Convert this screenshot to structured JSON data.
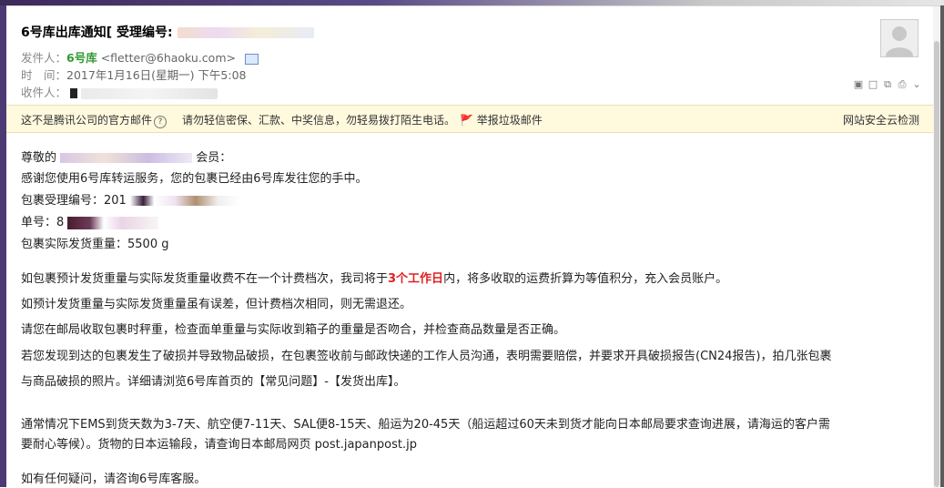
{
  "email": {
    "subject_prefix": "6号库出库通知[ 受理编号:",
    "from_label": "发件人：",
    "from_name": "6号库",
    "from_email": "<fletter@6haoku.com>",
    "time_label": "时　间：",
    "time_value": "2017年1月16日(星期一) 下午5:08",
    "to_label": "收件人："
  },
  "banner": {
    "notice": "这不是腾讯公司的官方邮件",
    "help": "?",
    "warning": "请勿轻信密保、汇款、中奖信息，勿轻易拨打陌生电话。",
    "report": "举报垃圾邮件",
    "report_icon": "🚩",
    "security": "网站安全云检测"
  },
  "content": {
    "greeting_prefix": "尊敬的",
    "greeting_suffix": "会员：",
    "thanks": "感谢您使用6号库转运服务，您的包裹已经由6号库发往您的手中。",
    "package_id_label": "包裹受理编号：201",
    "tracking_label": "单号：8",
    "weight": "包裹实际发货重量：5500 g",
    "p1_before": "如包裹预计发货重量与实际发货重量收费不在一个计费档次，我司将于",
    "p1_highlight": "3个工作日",
    "p1_after": "内，将多收取的运费折算为等值积分，充入会员账户。",
    "p2": "如预计发货重量与实际发货重量虽有误差，但计费档次相同，则无需退还。",
    "p3": "请您在邮局收取包裹时秤重，检查面单重量与实际收到箱子的重量是否吻合，并检查商品数量是否正确。",
    "p4a": "若您发现到达的包裹发生了破损并导致物品破损，在包裹签收前与邮政快递的工作人员沟通，表明需要赔偿，并要求开具破损报告(CN24报告)，拍几张包裹",
    "p4b": "与商品破损的照片。详细请浏览6号库首页的【常见问题】-【发货出库】。",
    "p5a": "通常情况下EMS到货天数为3-7天、航空便7-11天、SAL便8-15天、船运为20-45天（船运超过60天未到货才能向日本邮局要求查询进展，请海运的客户需",
    "p5b": "要耐心等候）。货物的日本运输段，请查询日本邮局网页 post.japanpost.jp",
    "p6": "如有任何疑问，请咨询6号库客服。"
  },
  "toolbar": {
    "icons": [
      "▣",
      "□",
      "⧉",
      "⎙",
      "⌄"
    ]
  },
  "colors": {
    "sender": "#339933",
    "highlight": "#e02020",
    "banner_bg": "#fff9de"
  }
}
